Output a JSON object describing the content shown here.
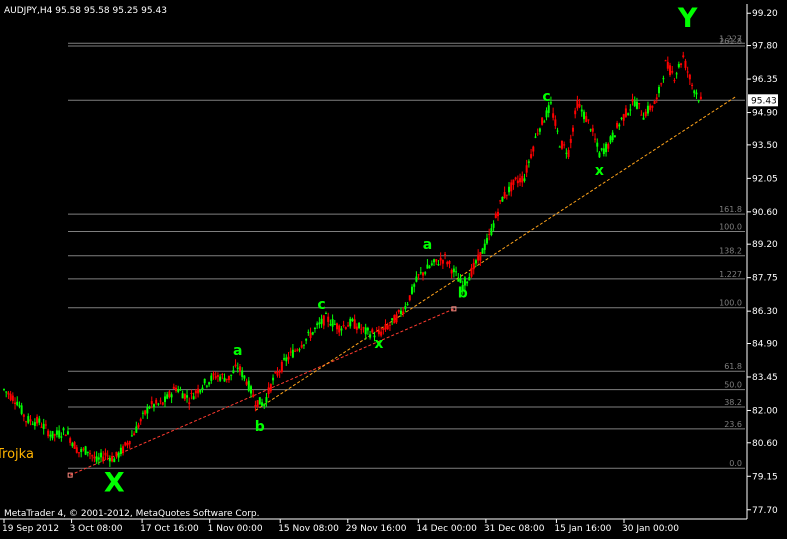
{
  "window": {
    "symbol_header": "AUDJPY,H4  95.58 95.58 95.25 95.43",
    "copyright": "MetaTrader 4, © 2001-2012, MetaQuotes Software Corp.",
    "indicator_label": "Trojka"
  },
  "colors": {
    "background": "#000000",
    "candle_up": "#00ff00",
    "candle_down": "#ff0000",
    "wave_labels": "#00ff00",
    "trendline_lower": "#ff3b30",
    "trendline_upper": "#ffa31a",
    "fib_lines": "#7f7f7f",
    "indicator": "#ffb300"
  },
  "chart_data": {
    "type": "candlestick",
    "symbol": "AUDJPY",
    "timeframe": "H4",
    "ohlc_last": {
      "open": 95.58,
      "high": 95.58,
      "low": 95.25,
      "close": 95.43
    },
    "current_price": 95.43,
    "y_ticks": [
      99.2,
      97.8,
      96.35,
      94.9,
      93.5,
      92.05,
      90.6,
      89.2,
      87.75,
      86.3,
      84.9,
      83.45,
      82.0,
      80.6,
      79.15,
      77.7
    ],
    "x_ticks": [
      "19 Sep 2012",
      "3 Oct 08:00",
      "17 Oct 16:00",
      "1 Nov 00:00",
      "15 Nov 08:00",
      "29 Nov 16:00",
      "14 Dec 00:00",
      "31 Dec 08:00",
      "15 Jan 16:00",
      "30 Jan 00:00"
    ],
    "ylim": [
      77.3,
      99.6
    ],
    "price_path": [
      [
        0,
        82.9
      ],
      [
        3,
        82.4
      ],
      [
        5,
        81.6
      ],
      [
        8,
        81.5
      ],
      [
        11,
        80.9
      ],
      [
        14,
        81.1
      ],
      [
        17,
        80.2
      ],
      [
        19,
        80.3
      ],
      [
        21,
        79.8
      ],
      [
        23,
        80.1
      ],
      [
        25,
        79.9
      ],
      [
        27,
        80.3
      ],
      [
        30,
        81.2
      ],
      [
        33,
        82.2
      ],
      [
        36,
        82.3
      ],
      [
        39,
        83.0
      ],
      [
        42,
        82.5
      ],
      [
        45,
        83.1
      ],
      [
        48,
        83.5
      ],
      [
        51,
        83.4
      ],
      [
        53,
        83.9
      ],
      [
        55,
        83.3
      ],
      [
        57,
        82.4
      ],
      [
        59,
        82.3
      ],
      [
        61,
        83.3
      ],
      [
        64,
        84.2
      ],
      [
        67,
        84.8
      ],
      [
        70,
        85.4
      ],
      [
        73,
        86.0
      ],
      [
        76,
        85.6
      ],
      [
        79,
        85.8
      ],
      [
        82,
        85.4
      ],
      [
        85,
        85.3
      ],
      [
        88,
        85.8
      ],
      [
        91,
        86.5
      ],
      [
        94,
        87.8
      ],
      [
        97,
        88.3
      ],
      [
        100,
        88.6
      ],
      [
        102,
        88.0
      ],
      [
        104,
        87.4
      ],
      [
        106,
        88.0
      ],
      [
        108,
        88.7
      ],
      [
        110,
        89.5
      ],
      [
        113,
        91.2
      ],
      [
        116,
        91.9
      ],
      [
        118,
        92.1
      ],
      [
        121,
        94.1
      ],
      [
        124,
        95.2
      ],
      [
        126,
        93.6
      ],
      [
        128,
        93.2
      ],
      [
        130,
        95.3
      ],
      [
        133,
        94.3
      ],
      [
        135,
        93.1
      ],
      [
        137,
        93.5
      ],
      [
        140,
        94.6
      ],
      [
        143,
        95.4
      ],
      [
        145,
        94.8
      ],
      [
        148,
        95.4
      ],
      [
        150,
        97.0
      ],
      [
        152,
        96.5
      ],
      [
        154,
        97.3
      ],
      [
        156,
        96.1
      ],
      [
        158,
        95.4
      ]
    ],
    "horizontal_levels": [
      {
        "label": "1.227",
        "price": 97.9
      },
      {
        "label": "261.8",
        "price": 97.78
      },
      {
        "label": "",
        "price": 95.43
      },
      {
        "label": "161.8",
        "price": 90.5
      },
      {
        "label": "100.0",
        "price": 89.75
      },
      {
        "label": "138.2",
        "price": 88.7
      },
      {
        "label": "1.227",
        "price": 87.7
      },
      {
        "label": "100.0",
        "price": 86.45
      },
      {
        "label": "61.8",
        "price": 83.7
      },
      {
        "label": "50.0",
        "price": 82.9
      },
      {
        "label": "38.2",
        "price": 82.15
      },
      {
        "label": "23.6",
        "price": 81.2
      },
      {
        "label": "0.0",
        "price": 79.5
      }
    ],
    "trendlines": [
      {
        "from": [
          15,
          79.2
        ],
        "to": [
          102,
          86.4
        ]
      },
      {
        "from": [
          57,
          82.0
        ],
        "to": [
          166,
          95.6
        ]
      }
    ],
    "wave_labels": [
      {
        "text": "X",
        "t": 25,
        "price": 78.5,
        "size": "big"
      },
      {
        "text": "a",
        "t": 53,
        "price": 84.4
      },
      {
        "text": "b",
        "t": 58,
        "price": 81.1
      },
      {
        "text": "c",
        "t": 72,
        "price": 86.4
      },
      {
        "text": "x",
        "t": 85,
        "price": 84.7
      },
      {
        "text": "a",
        "t": 96,
        "price": 89.0
      },
      {
        "text": "b",
        "t": 104,
        "price": 86.9
      },
      {
        "text": "c",
        "t": 123,
        "price": 95.4
      },
      {
        "text": "x",
        "t": 135,
        "price": 92.2
      },
      {
        "text": "Y",
        "t": 155,
        "price": 98.6,
        "size": "big"
      }
    ]
  }
}
